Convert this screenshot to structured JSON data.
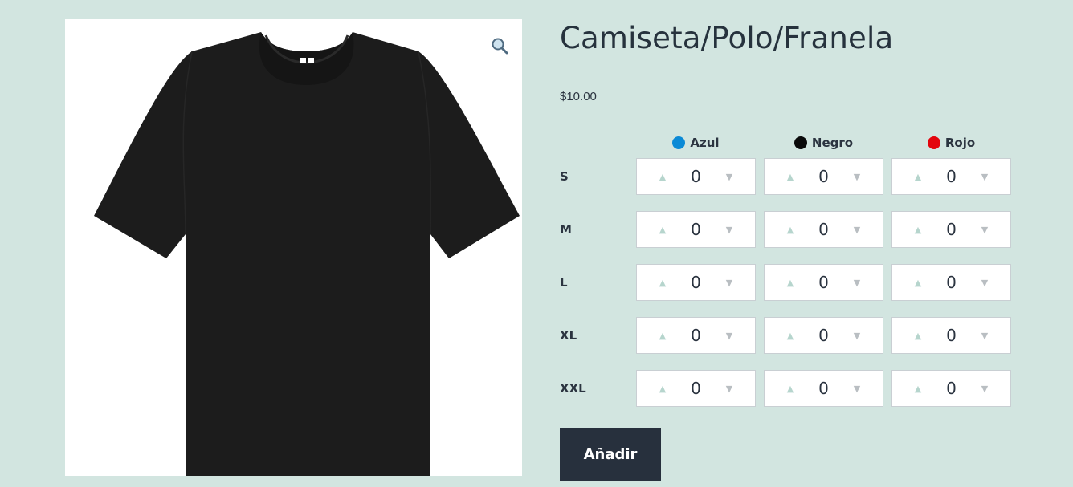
{
  "product": {
    "title": "Camiseta/Polo/Franela",
    "price": "$10.00",
    "image_icon": "tshirt-image",
    "zoom_icon": "magnifier-icon"
  },
  "variations": {
    "colors": [
      {
        "label": "Azul",
        "swatch": "#0b8ad6"
      },
      {
        "label": "Negro",
        "swatch": "#0a0a0a"
      },
      {
        "label": "Rojo",
        "swatch": "#e3050d"
      }
    ],
    "sizes": [
      "S",
      "M",
      "L",
      "XL",
      "XXL"
    ],
    "quantities": [
      [
        "0",
        "0",
        "0"
      ],
      [
        "0",
        "0",
        "0"
      ],
      [
        "0",
        "0",
        "0"
      ],
      [
        "0",
        "0",
        "0"
      ],
      [
        "0",
        "0",
        "0"
      ]
    ],
    "up_glyph": "▲",
    "down_glyph": "▼"
  },
  "actions": {
    "add_label": "Añadir"
  }
}
